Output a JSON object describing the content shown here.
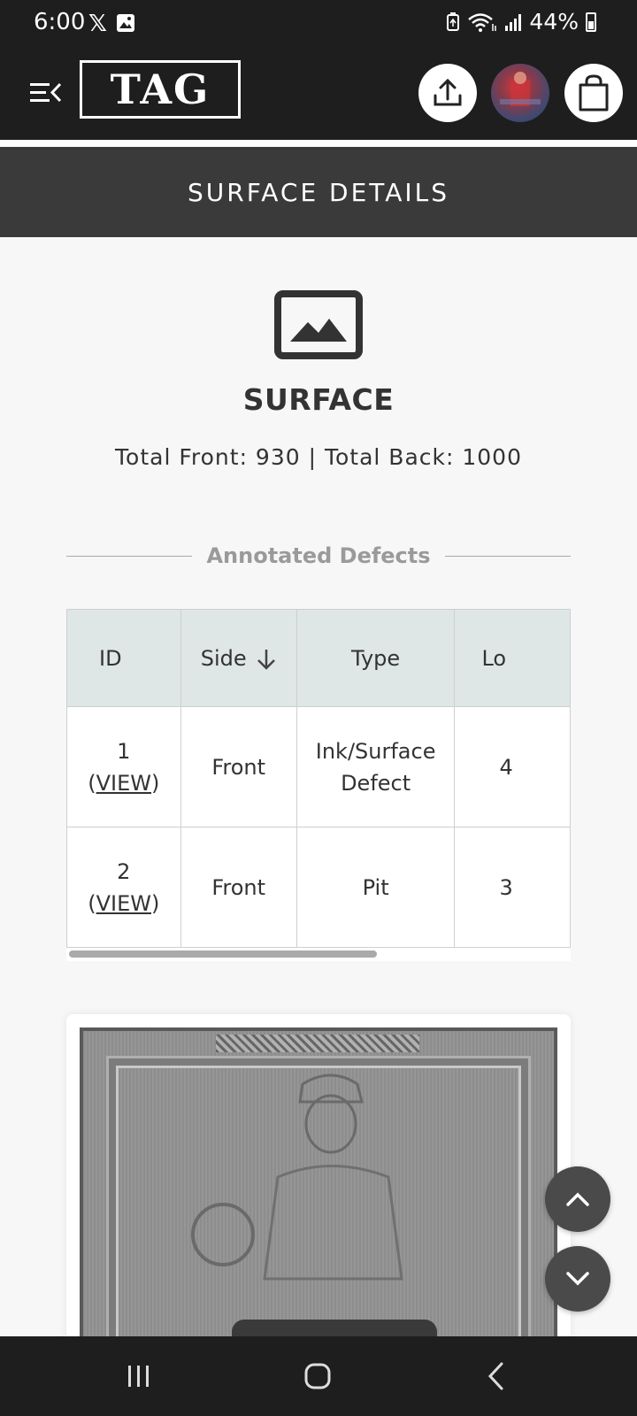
{
  "status_bar": {
    "time": "6:00",
    "x_icon": "x-logo-icon",
    "image_icon": "image-icon",
    "battery_percent": "44%"
  },
  "header": {
    "logo_text": "TAG",
    "menu_icon": "menu-collapse-icon",
    "upload_icon": "upload-icon",
    "cart_icon": "shopping-bag-icon"
  },
  "section": {
    "title": "SURFACE DETAILS"
  },
  "surface": {
    "icon": "image-placeholder-icon",
    "heading": "SURFACE",
    "totals": "Total Front: 930 | Total Back: 1000"
  },
  "defects": {
    "label": "Annotated Defects",
    "columns": [
      "ID",
      "Side",
      "Type",
      "Lo"
    ],
    "rows": [
      {
        "id": "1",
        "view": "VIEW",
        "side": "Front",
        "type_line1": "Ink/Surface",
        "type_line2": "Defect",
        "loc": "4"
      },
      {
        "id": "2",
        "view": "VIEW",
        "side": "Front",
        "type_line1": "Pit",
        "type_line2": "",
        "loc": "3"
      }
    ]
  },
  "fabs": {
    "up_icon": "chevron-up-icon",
    "down_icon": "chevron-down-icon"
  },
  "nav": {
    "recents_icon": "recents-icon",
    "home_icon": "home-icon",
    "back_icon": "back-icon"
  },
  "colors": {
    "header_bg": "#1e1e1e",
    "section_bg": "#3a3a3a",
    "table_header_bg": "#dfe6e6"
  }
}
